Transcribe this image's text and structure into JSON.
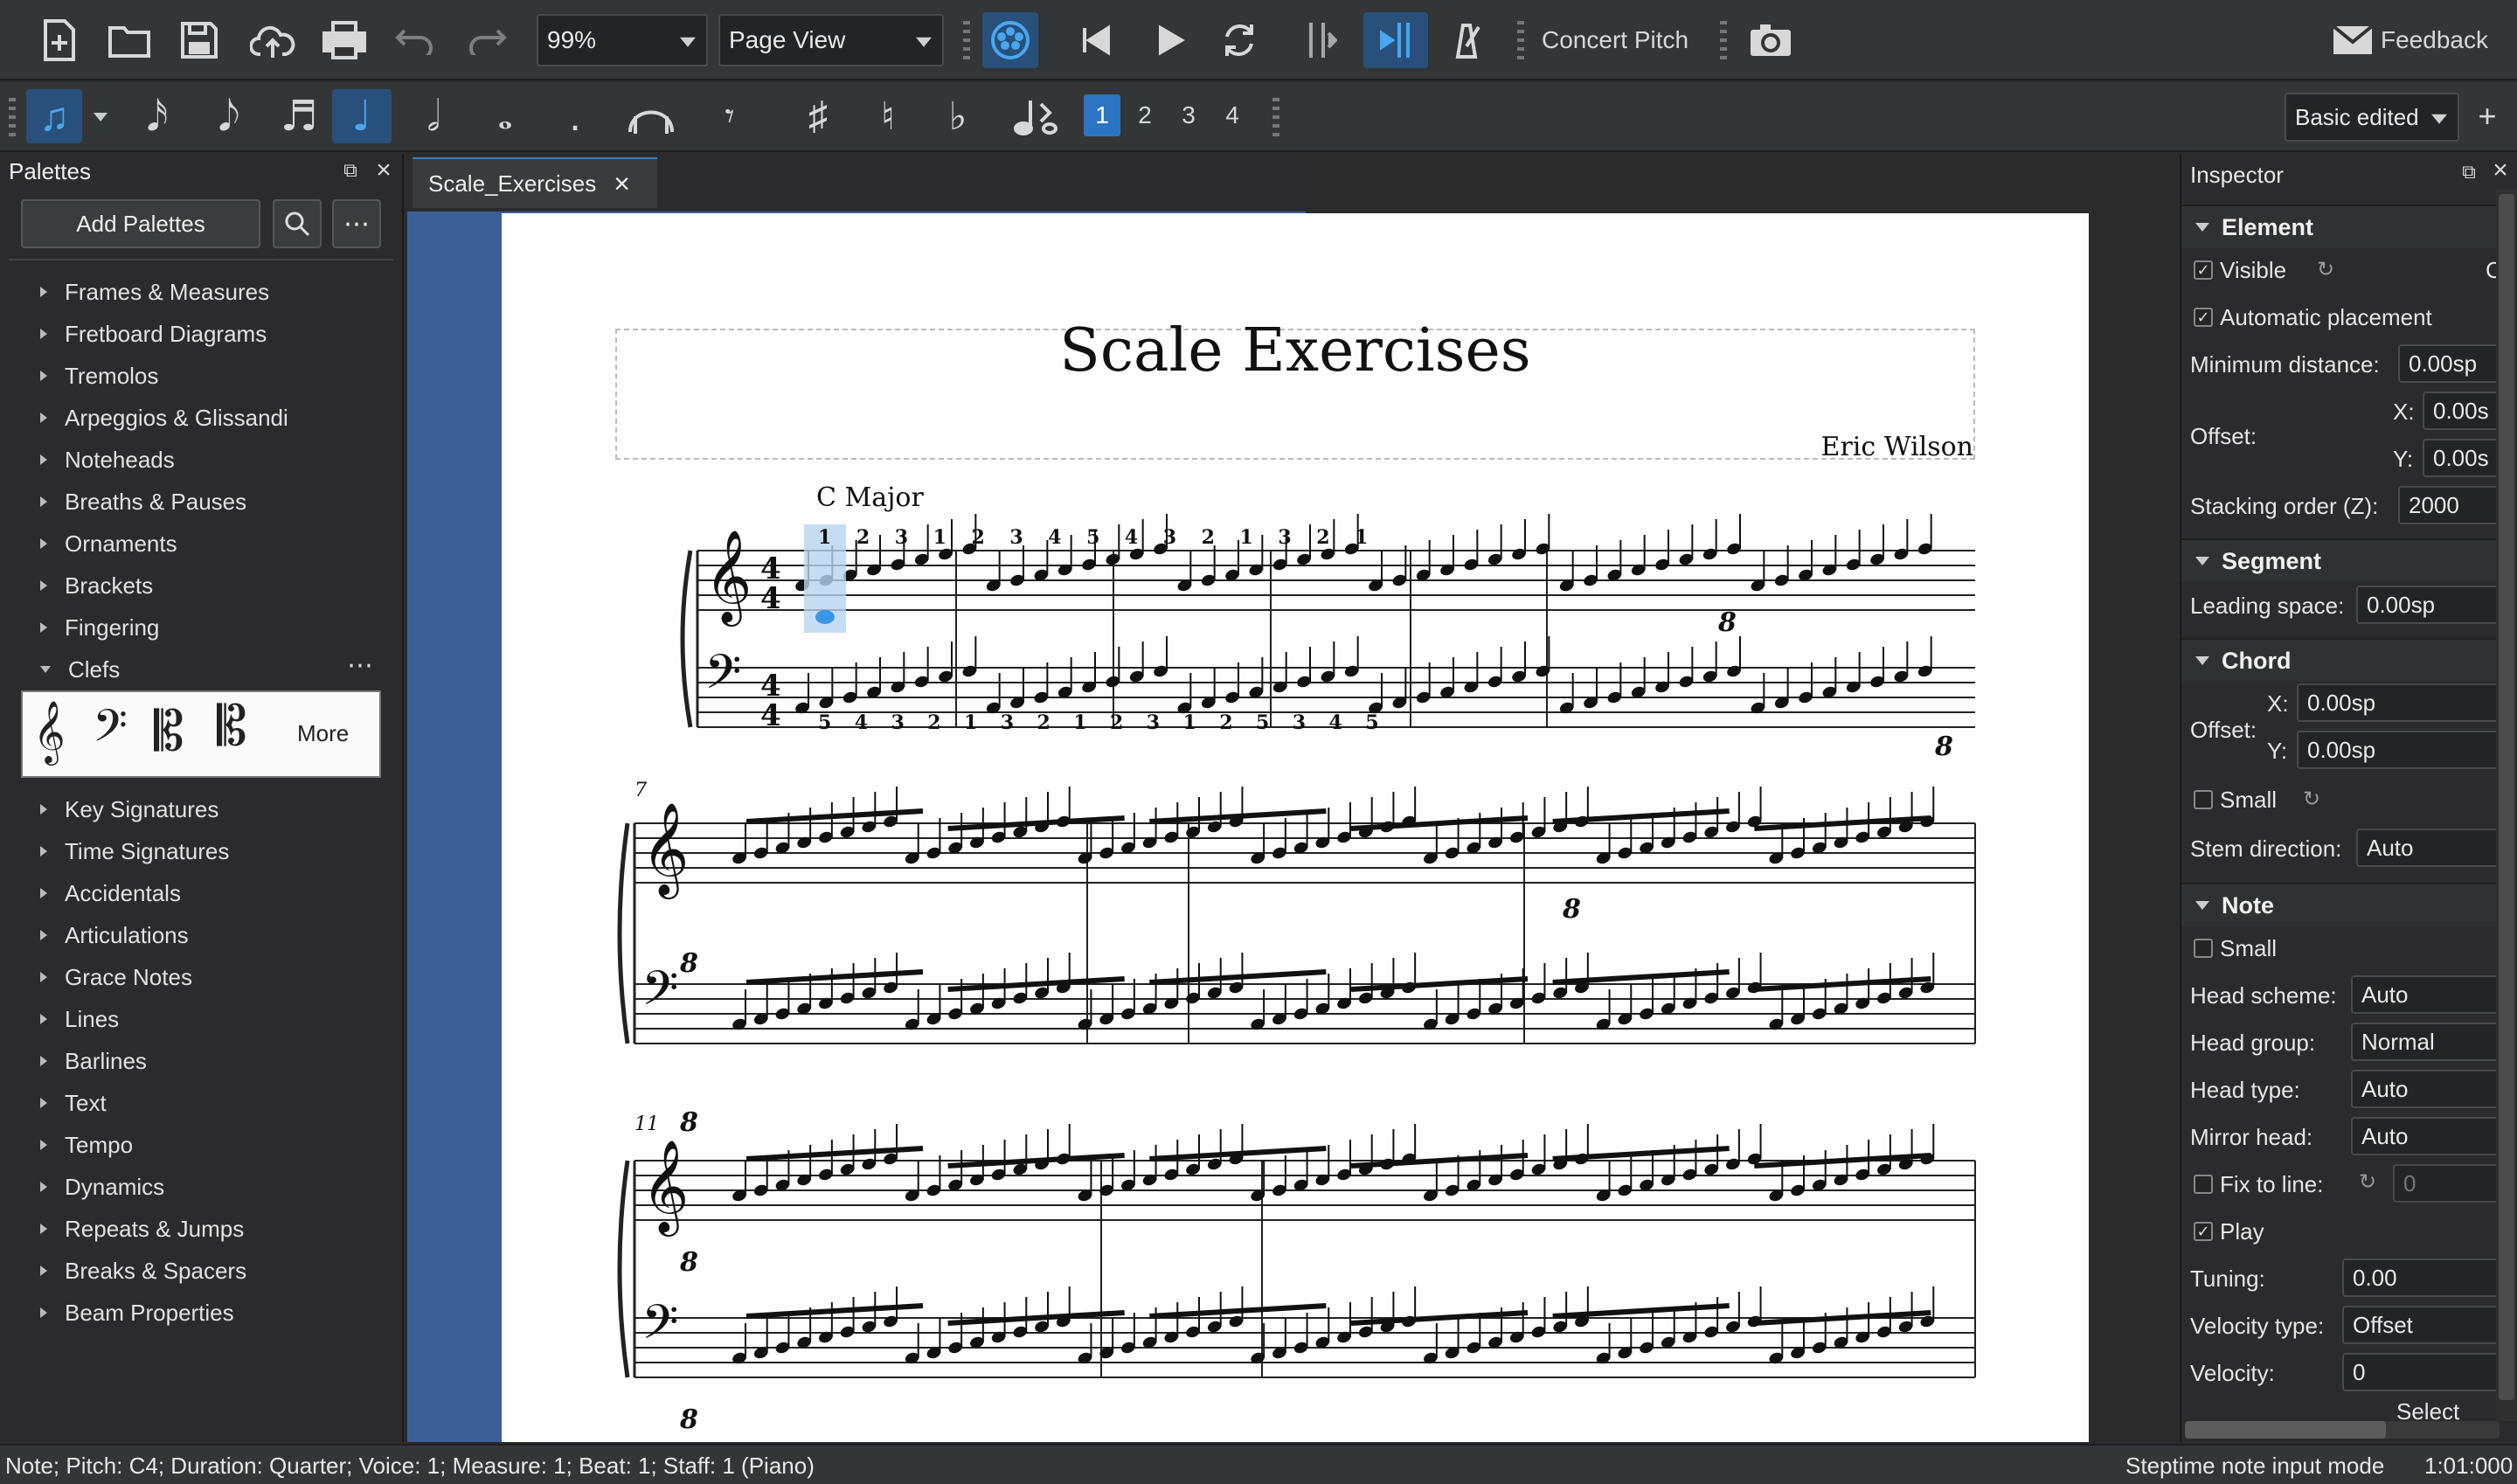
{
  "toolbar": {
    "zoom": "99%",
    "view_mode": "Page View",
    "concert_pitch": "Concert Pitch",
    "feedback": "Feedback"
  },
  "note_input": {
    "voices": [
      "1",
      "2",
      "3",
      "4"
    ],
    "workspace": "Basic edited",
    "plus": "+"
  },
  "palettes": {
    "title": "Palettes",
    "add_button": "Add Palettes",
    "more_label": "More",
    "items_top": [
      "Frames & Measures",
      "Fretboard Diagrams",
      "Tremolos",
      "Arpeggios & Glissandi",
      "Noteheads",
      "Breaths & Pauses",
      "Ornaments",
      "Brackets",
      "Fingering",
      "Clefs"
    ],
    "items_bottom": [
      "Key Signatures",
      "Time Signatures",
      "Accidentals",
      "Articulations",
      "Grace Notes",
      "Lines",
      "Barlines",
      "Text",
      "Tempo",
      "Dynamics",
      "Repeats & Jumps",
      "Breaks & Spacers",
      "Beam Properties"
    ]
  },
  "score": {
    "tab": "Scale_Exercises",
    "title": "Scale Exercises",
    "composer": "Eric Wilson",
    "section": "C Major",
    "measure_7": "7",
    "measure_11": "11"
  },
  "inspector": {
    "title": "Inspector",
    "element": {
      "header": "Element",
      "visible": "Visible",
      "col": "Col",
      "auto_place": "Automatic placement",
      "min_dist_label": "Minimum distance:",
      "min_dist": "0.00sp",
      "offset_label": "Offset:",
      "x_label": "X:",
      "x": "0.00s",
      "y_label": "Y:",
      "y": "0.00s",
      "stack_label": "Stacking order (Z):",
      "stack": "2000"
    },
    "segment": {
      "header": "Segment",
      "leading_label": "Leading space:",
      "leading": "0.00sp"
    },
    "chord": {
      "header": "Chord",
      "offset_label": "Offset:",
      "x_label": "X:",
      "x": "0.00sp",
      "y_label": "Y:",
      "y": "0.00sp",
      "small": "Small",
      "stem_label": "Stem direction:",
      "stem": "Auto"
    },
    "note": {
      "header": "Note",
      "small": "Small",
      "head_scheme_label": "Head scheme:",
      "head_scheme": "Auto",
      "head_group_label": "Head group:",
      "head_group": "Normal",
      "head_type_label": "Head type:",
      "head_type": "Auto",
      "mirror_label": "Mirror head:",
      "mirror": "Auto",
      "fix_label": "Fix to line:",
      "fix": "0",
      "play": "Play",
      "tuning_label": "Tuning:",
      "tuning": "0.00",
      "vel_type_label": "Velocity type:",
      "vel_type": "Offset",
      "velocity_label": "Velocity:",
      "velocity": "0",
      "select": "Select"
    }
  },
  "status": {
    "left": "Note; Pitch: C4; Duration: Quarter; Voice: 1;  Measure: 1; Beat: 1; Staff: 1 (Piano)",
    "mode": "Steptime note input mode",
    "time": "1:01:000"
  },
  "fingerings": {
    "m1_top": [
      "1",
      "2",
      "3",
      "1",
      "2",
      "3",
      "4",
      "5",
      "4",
      "3",
      "2",
      "1",
      "3",
      "2",
      "1"
    ],
    "m1_bot": [
      "5",
      "4",
      "3",
      "2",
      "1",
      "3",
      "2",
      "1",
      "2",
      "3",
      "1",
      "2",
      "5",
      "3",
      "4",
      "5"
    ]
  },
  "colors": {
    "accent": "#3a95e6",
    "canvas": "#3c6096",
    "panel": "#2b2b2d"
  }
}
